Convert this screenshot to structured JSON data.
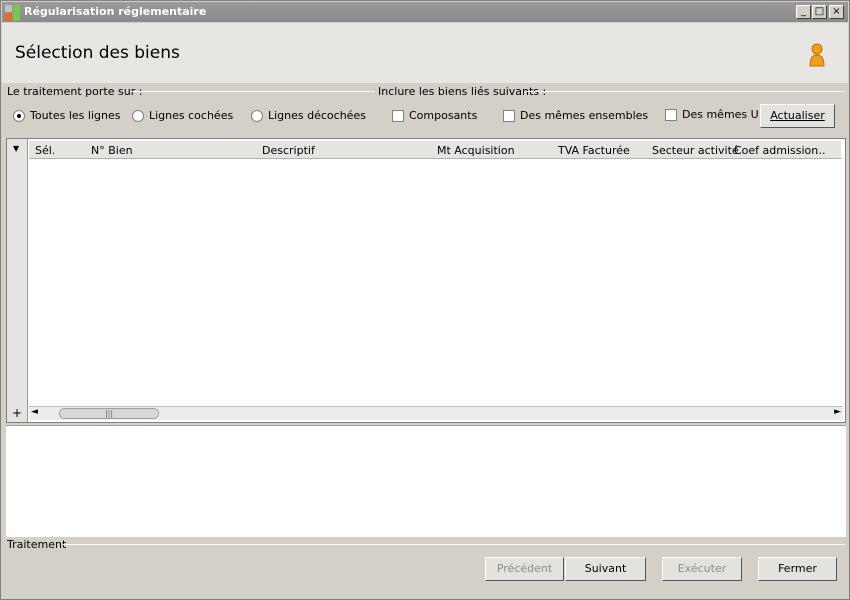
{
  "titlebar": {
    "title": "Régularisation réglementaire",
    "min": "_",
    "max": "□",
    "close": "×"
  },
  "header": {
    "title": "Sélection des biens"
  },
  "group_traitement": {
    "label": "Le traitement porte sur :"
  },
  "group_inclure": {
    "label": "Inclure les biens liés suivants :"
  },
  "options": {
    "all": "Toutes les lignes",
    "checked": "Lignes cochées",
    "unchecked": "Lignes décochées",
    "components": "Composants",
    "same_sets": "Des mêmes ensembles",
    "same_u": "Des mêmes U."
  },
  "actualiser": "Actualiser",
  "grid": {
    "columns": [
      "Sél.",
      "N° Bien",
      "Descriptif",
      "Mt Acquisition",
      "TVA Facturée",
      "Secteur activité",
      "Coef admission",
      "..."
    ],
    "add_symbol": "+",
    "scroll_left": "◄",
    "scroll_right": "►",
    "thumb_grip": "|||"
  },
  "footer": {
    "label": "Traitement",
    "prev": "Précédent",
    "next": "Suivant",
    "execute": "Exécuter",
    "close": "Fermer"
  }
}
